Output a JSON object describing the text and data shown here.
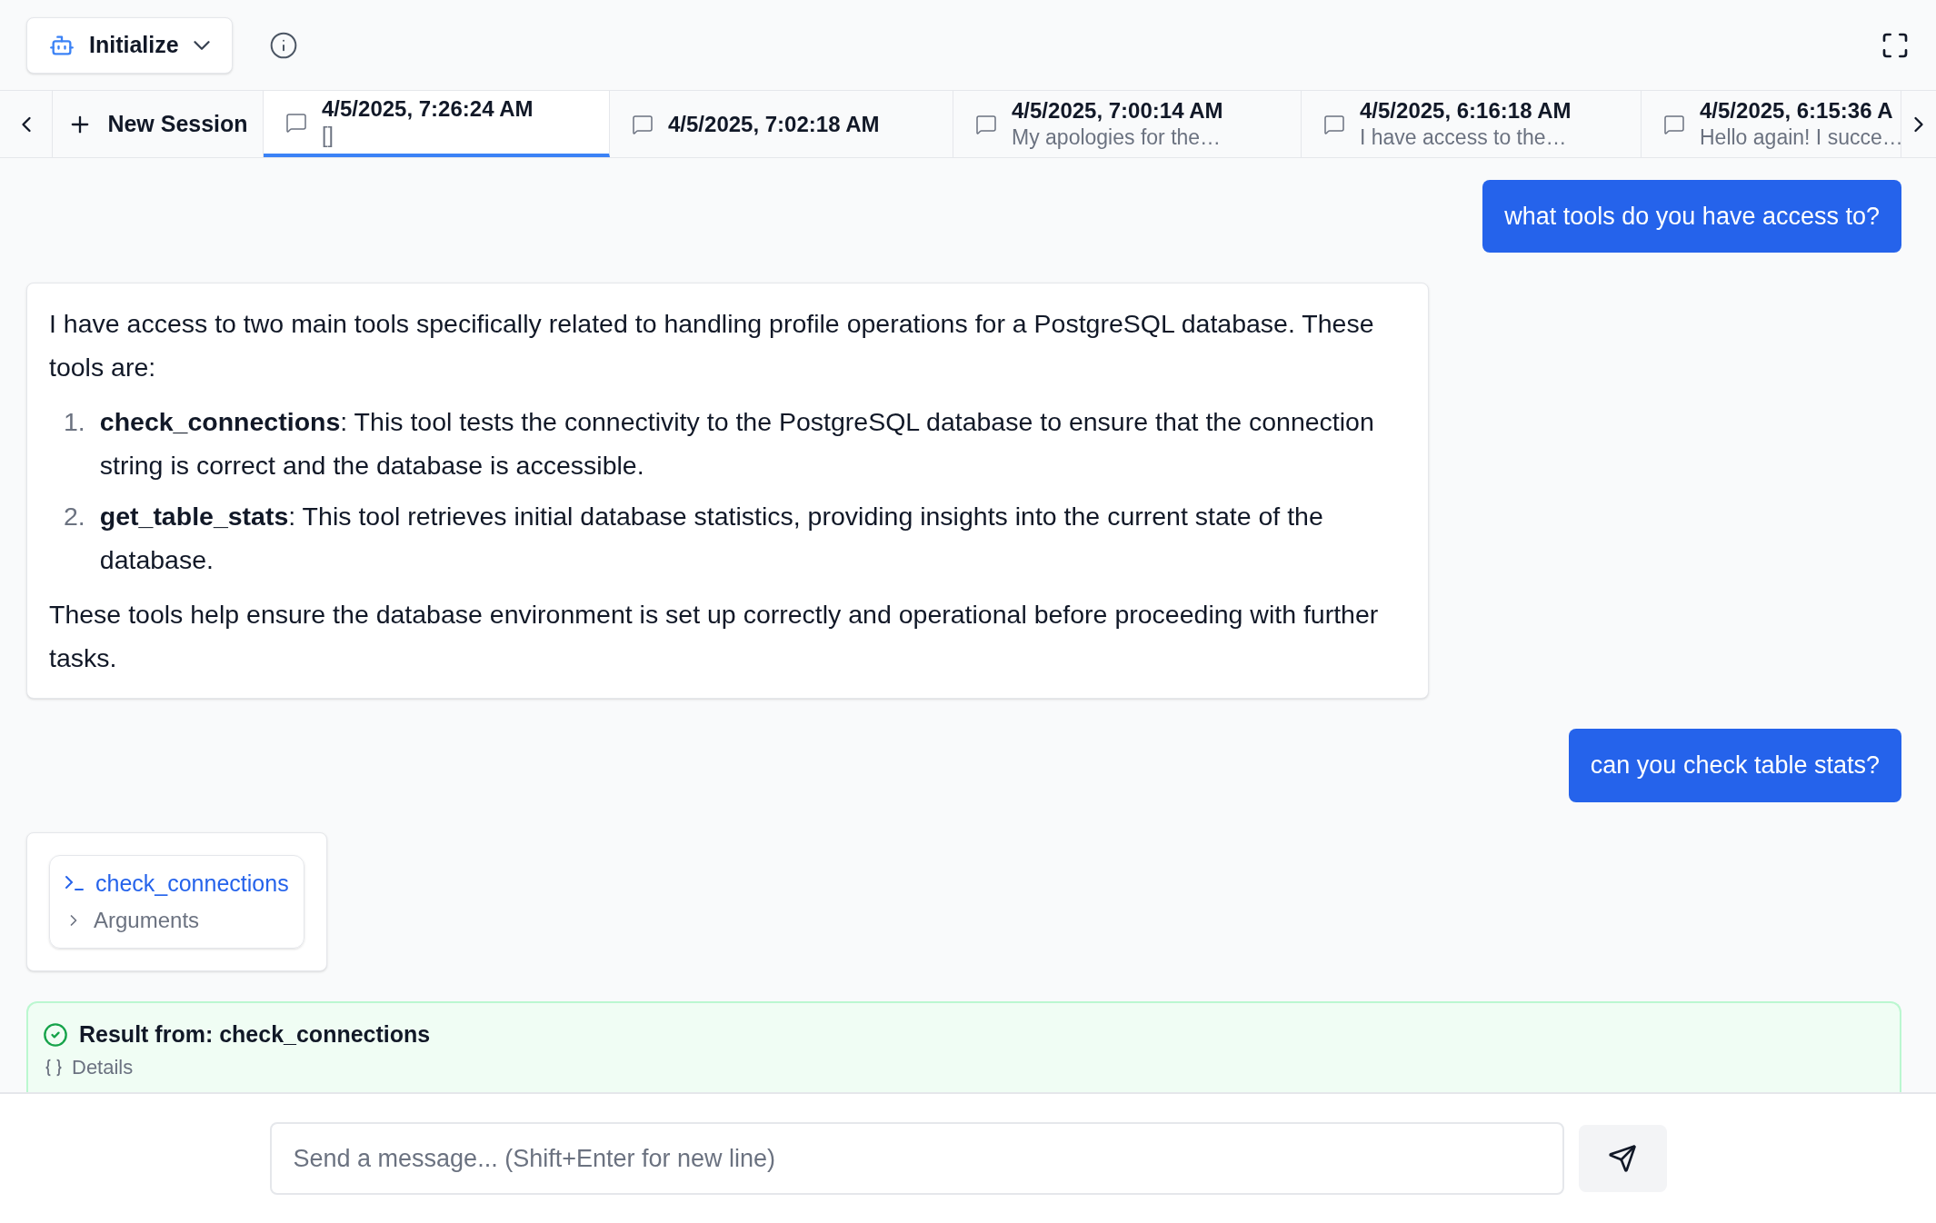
{
  "toolbar": {
    "agent_button": {
      "label": "Initialize"
    }
  },
  "session_tabs": {
    "new_session": "New Session",
    "tabs": [
      {
        "title": "4/5/2025, 7:26:24 AM",
        "subtitle": "[]",
        "selected": true
      },
      {
        "title": "4/5/2025, 7:02:18 AM",
        "selected": false
      },
      {
        "title": "4/5/2025, 7:00:14 AM",
        "subtitle": "My apologies for the…",
        "selected": false
      },
      {
        "title": "4/5/2025, 6:16:18 AM",
        "subtitle": "I have access to the…",
        "selected": false
      },
      {
        "title": "4/5/2025, 6:15:36 A",
        "subtitle": "Hello again! I succe…",
        "selected": false
      }
    ]
  },
  "messages": [
    {
      "kind": "user",
      "text": "what tools do you have access to?"
    },
    {
      "kind": "assistant",
      "intro": "I have access to two main tools specifically related to handling profile operations for a PostgreSQL database. These tools are:",
      "items": [
        {
          "number": "1.",
          "text": "**check_connections**: This tool tests the connectivity to the PostgreSQL database to ensure that the connection string is correct and the database is accessible."
        },
        {
          "number": "2.",
          "text": "**get_table_stats**: This tool retrieves initial database statistics, providing insights into the current state of the database."
        }
      ],
      "outro": "These tools help ensure the database environment is set up correctly and operational before proceeding with further tasks."
    },
    {
      "kind": "user",
      "text": "can you check table stats?"
    },
    {
      "kind": "tool_call",
      "tool": "check_connections",
      "arguments_label": "Arguments",
      "expanded": false
    },
    {
      "kind": "tool_result",
      "title": "Result from: check_connections",
      "details_label": "Details"
    }
  ],
  "composer": {
    "placeholder": "Send a message... (Shift+Enter for new line)"
  }
}
